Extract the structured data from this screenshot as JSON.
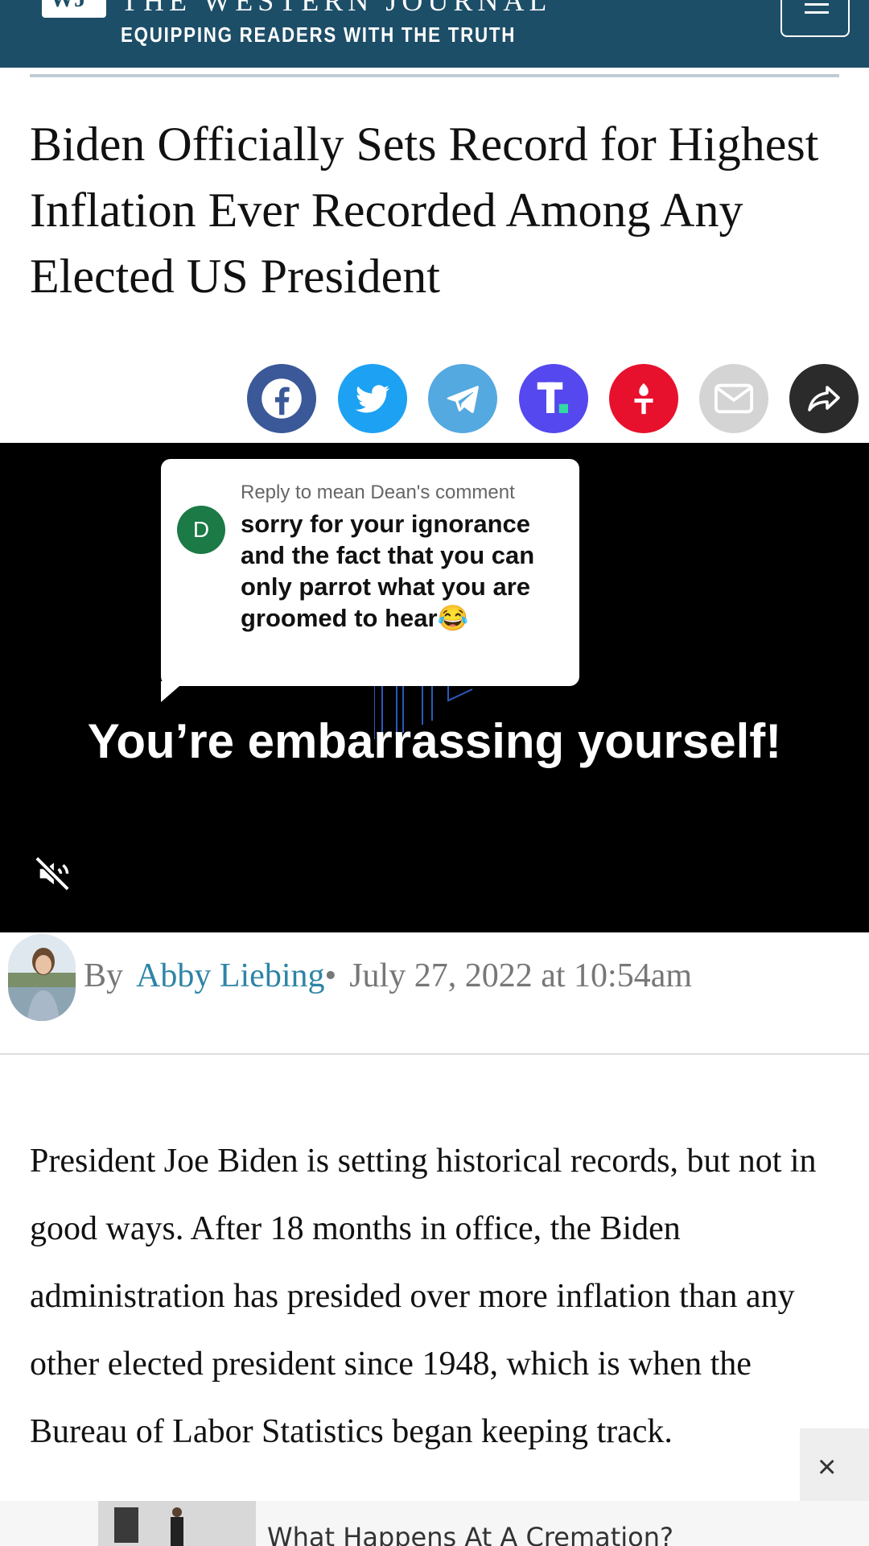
{
  "header": {
    "logo_text": "WJ",
    "masthead": "THE WESTERN JOURNAL",
    "tagline": "EQUIPPING READERS WITH THE TRUTH"
  },
  "article": {
    "headline": "Biden Officially Sets Record for Highest Inflation Ever Recorded Among Any Elected US President",
    "body": "President Joe Biden is setting historical records, but not in good ways. After 18 months in office, the Biden administration has presided over more inflation than any other elected president since 1948, which is when the Bureau of Labor Statistics began keeping track."
  },
  "share": {
    "icons": [
      "facebook-icon",
      "twitter-icon",
      "telegram-icon",
      "truth-social-icon",
      "gettr-icon",
      "email-icon",
      "share-icon"
    ],
    "truth_letter": "T"
  },
  "video": {
    "reply_to": "Reply to mean Dean's comment",
    "avatar_letter": "D",
    "reply_text": "sorry for your ignorance and the fact that you can only parrot what you are groomed to hear😂",
    "caption": "You’re embarrassing yourself!"
  },
  "byline": {
    "by": "By",
    "author": "Abby Liebing",
    "separator": "•",
    "date": "July 27, 2022 at 10:54am"
  },
  "ad": {
    "text": "What Happens At A Cremation?",
    "close": "×"
  },
  "colors": {
    "header_bg": "#1d4e68",
    "facebook": "#3b5998",
    "twitter": "#1da1f2",
    "telegram": "#54a9e0",
    "truth_social": "#5448ee",
    "gettr": "#e8112d",
    "email": "#d4d4d4",
    "share": "#2b2b2b",
    "author_link": "#2e84a6"
  }
}
